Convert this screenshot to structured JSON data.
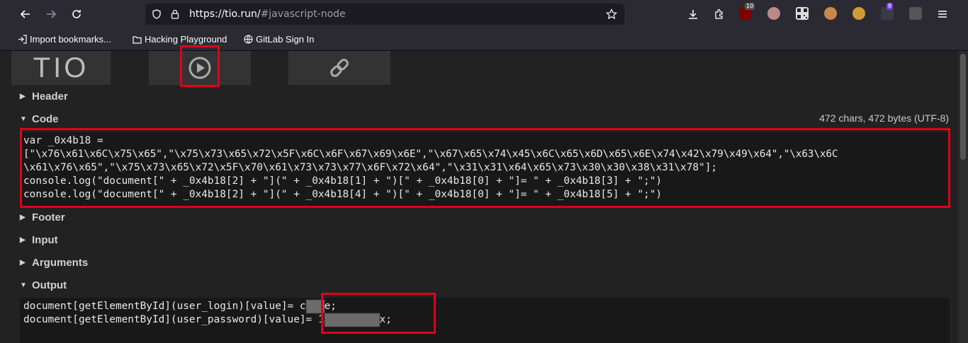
{
  "browser": {
    "url_host": "https://tio.run/",
    "url_rest": "#javascript-node",
    "bookmarks": [
      {
        "label": "Import bookmarks..."
      },
      {
        "label": "Hacking Playground"
      },
      {
        "label": "GitLab Sign In"
      }
    ],
    "extension_badges": {
      "ublock": "10",
      "purple": "8"
    }
  },
  "tio": {
    "logo": "TIO",
    "sections": {
      "header": "Header",
      "code": "Code",
      "footer": "Footer",
      "input": "Input",
      "arguments": "Arguments",
      "output": "Output"
    },
    "char_count": "472 chars, 472 bytes (UTF-8)",
    "code_lines": [
      "var _0x4b18 =",
      "[\"\\x76\\x61\\x6C\\x75\\x65\",\"\\x75\\x73\\x65\\x72\\x5F\\x6C\\x6F\\x67\\x69\\x6E\",\"\\x67\\x65\\x74\\x45\\x6C\\x65\\x6D\\x65\\x6E\\x74\\x42\\x79\\x49\\x64\",\"\\x63\\x6C",
      "\\x61\\x76\\x65\",\"\\x75\\x73\\x65\\x72\\x5F\\x70\\x61\\x73\\x73\\x77\\x6F\\x72\\x64\",\"\\x31\\x31\\x64\\x65\\x73\\x30\\x30\\x38\\x31\\x78\"];",
      "console.log(\"document[\" + _0x4b18[2] + \"](\" + _0x4b18[1] + \")[\" + _0x4b18[0] + \"]= \" + _0x4b18[3] + \";\")",
      "console.log(\"document[\" + _0x4b18[2] + \"](\" + _0x4b18[4] + \")[\" + _0x4b18[0] + \"]= \" + _0x4b18[5] + \";\")"
    ],
    "output_lines": [
      {
        "prefix": "document[getElementById](user_login)[value]= ",
        "visible_start": "c",
        "visible_end": "e;"
      },
      {
        "prefix": "document[getElementById](user_password)[value]= ",
        "visible_start": "1",
        "visible_end": "x;"
      }
    ]
  }
}
